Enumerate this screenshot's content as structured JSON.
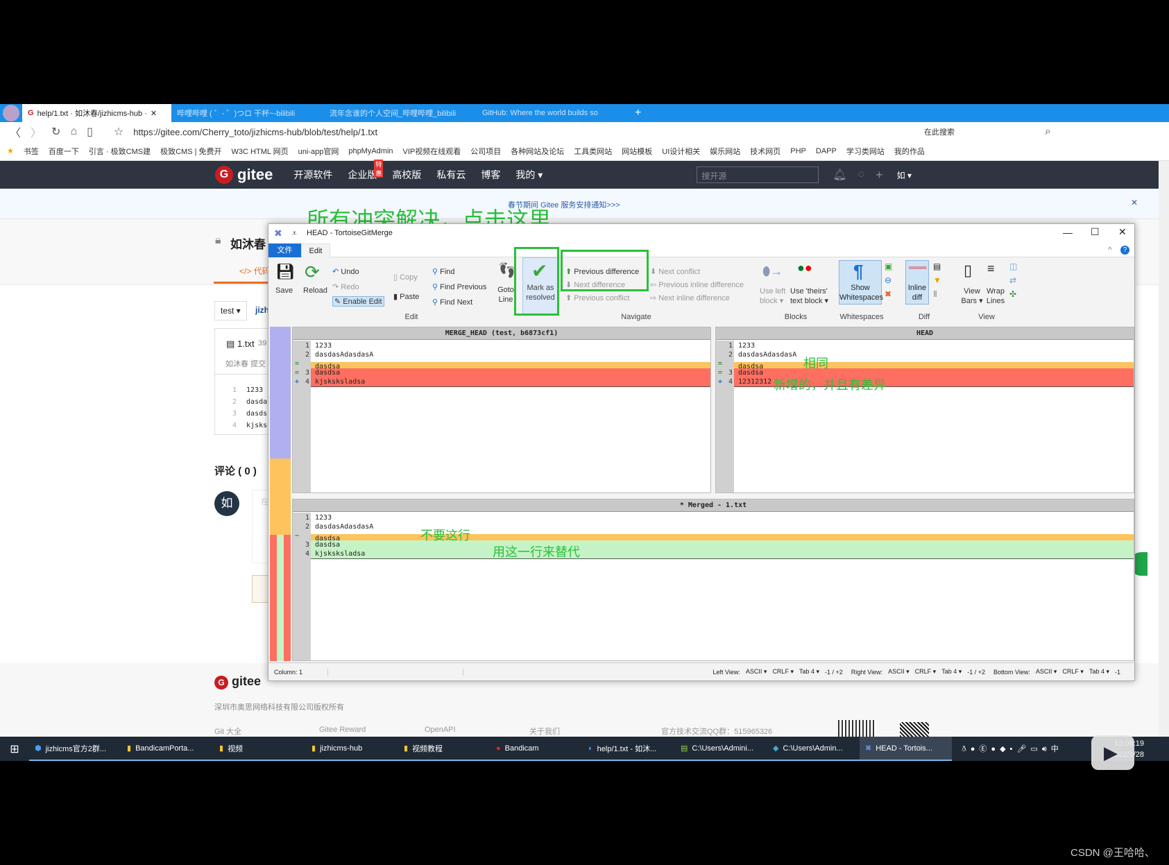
{
  "browser": {
    "tabs": [
      {
        "label": "help/1.txt · 如沐春/jizhicms-hub ·"
      },
      {
        "label": "哔哩哔哩 ( ゜- ゜)つロ 干杯~-bilibili"
      },
      {
        "label": "流年念谁的个人空间_哔哩哔哩_bilibili"
      },
      {
        "label": "GitHub: Where the world builds so"
      }
    ],
    "new_tab": "+",
    "url": "https://gitee.com/Cherry_toto/jizhicms-hub/blob/test/help/1.txt",
    "search_placeholder": "在此搜索",
    "bookmarks": [
      "书签",
      "百度一下",
      "引言 · 极致CMS建",
      "极致CMS | 免费开",
      "W3C HTML 网页",
      "uni-app官网",
      "phpMyAdmin",
      "VIP视频在线观看",
      "公司项目",
      "各种网站及论坛",
      "工具类网站",
      "网站模板",
      "UI设计相关",
      "娱乐网站",
      "技术网页",
      "PHP",
      "DAPP",
      "学习类网站",
      "我的作品"
    ]
  },
  "gitee": {
    "logo": "gitee",
    "nav": [
      "开源软件",
      "企业版",
      "高校版",
      "私有云",
      "博客",
      "我的 ▾"
    ],
    "badge": "特惠",
    "search_placeholder": "搜开源",
    "user": "如 ▾",
    "notice": "春节期间 Gitee 服务安排通知>>>",
    "repo_title": "如沐春",
    "code_tab": "</> 代码",
    "branch": "test ▾",
    "repo_link": "jizh",
    "file_name": "1.txt",
    "file_size": "39",
    "commit": "如沐春 提交",
    "file_lines": [
      {
        "n": "1",
        "t": "1233"
      },
      {
        "n": "2",
        "t": "dasda"
      },
      {
        "n": "3",
        "t": "dasds"
      },
      {
        "n": "4",
        "t": "kjsks"
      }
    ],
    "comments": "评论 ( 0 )",
    "avatar": "如",
    "comment_placeholder": "在",
    "footer_logo": "gitee",
    "copyright": "深圳市奥思网络科技有限公司版权所有",
    "footer_links": [
      "Git 大全",
      "Gitee Reward",
      "OpenAPI",
      "关于我们",
      "官方技术交流QQ群：515965326"
    ]
  },
  "merge": {
    "title": "HEAD - TortoiseGitMerge",
    "tabs": [
      "文件",
      "Edit"
    ],
    "edit": {
      "save": "Save",
      "reload": "Reload",
      "undo": "Undo",
      "redo": "Redo",
      "enable_edit": "Enable Edit",
      "copy": "Copy",
      "paste": "Paste",
      "find": "Find",
      "find_previous": "Find Previous",
      "find_next": "Find Next",
      "goto_line": "Goto Line",
      "mark_resolved": "Mark as resolved"
    },
    "navigate": {
      "prev_diff": "Previous difference",
      "next_diff": "Next difference",
      "prev_conflict": "Previous conflict",
      "next_conflict": "Next conflict",
      "prev_inline": "Previous inline difference",
      "next_inline": "Next inline difference"
    },
    "blocks": {
      "use_left": "Use left block ▾",
      "use_theirs": "Use 'theirs' text block ▾"
    },
    "whitespaces": {
      "show": "Show Whitespaces"
    },
    "diff": {
      "inline": "Inline diff"
    },
    "view": {
      "view_bars": "View Bars ▾",
      "wrap_lines": "Wrap Lines"
    },
    "groups": [
      "Edit",
      "Navigate",
      "Blocks",
      "Whitespaces",
      "Diff",
      "View"
    ],
    "left_pane": {
      "header": "MERGE_HEAD (test, b6873cf1)",
      "lines": [
        {
          "mark": "",
          "n": "1",
          "text": "1233",
          "state": "normal"
        },
        {
          "mark": "",
          "n": "2",
          "text": "dasdasAdasdasA",
          "state": "normal"
        },
        {
          "mark": "=",
          "n": "",
          "text": "dasdsa",
          "state": "removed"
        },
        {
          "mark": "=",
          "n": "3",
          "text": "dasdsa",
          "state": "conflict"
        },
        {
          "mark": "+",
          "n": "4",
          "text": "kjsksksladsa",
          "state": "conflict"
        }
      ]
    },
    "right_pane": {
      "header": "HEAD",
      "lines": [
        {
          "mark": "",
          "n": "1",
          "text": "1233",
          "state": "normal"
        },
        {
          "mark": "",
          "n": "2",
          "text": "dasdasAdasdasA",
          "state": "normal"
        },
        {
          "mark": "=",
          "n": "",
          "text": "dasdsa",
          "state": "removed"
        },
        {
          "mark": "=",
          "n": "3",
          "text": "dasdsa",
          "state": "conflict"
        },
        {
          "mark": "+",
          "n": "4",
          "text": "12312312",
          "state": "conflict"
        }
      ]
    },
    "bottom_pane": {
      "header": "* Merged - 1.txt",
      "lines": [
        {
          "mark": "",
          "n": "1",
          "text": "1233",
          "state": "normal"
        },
        {
          "mark": "",
          "n": "2",
          "text": "dasdasAdasdasA",
          "state": "normal"
        },
        {
          "mark": "−",
          "n": "",
          "text": "dasdsa",
          "state": "removed"
        },
        {
          "mark": "",
          "n": "3",
          "text": "dasdsa",
          "state": "resolved"
        },
        {
          "mark": "",
          "n": "4",
          "text": "kjsksksladsa",
          "state": "resolved"
        }
      ]
    },
    "status": {
      "column": "Column: 1",
      "left_view": "Left View:",
      "right_view": "Right View:",
      "bottom_view": "Bottom View:",
      "encoding": "ASCII ▾",
      "eol": "CRLF ▾",
      "tab": "Tab 4 ▾",
      "left_count": "-1 / +2",
      "right_count": "-1 / +2",
      "bottom_count": "-1"
    },
    "colors": {
      "removed": "#fdc35c",
      "conflict": "#ff6f61",
      "resolved": "#c6f3c6",
      "accent": "#1f6fd6"
    }
  },
  "annotations": {
    "click_here": "所有冲突解决，点击这里",
    "same": "相同",
    "added_diff": "新增的，并且有差异",
    "drop_line": "不要这行",
    "replace_line": "用这一行来替代",
    "color": "#2bbf3b"
  },
  "taskbar": {
    "items": [
      "jizhicms官方2群...",
      "BandicamPorta...",
      "视频",
      "jizhicms-hub",
      "视频教程",
      "Bandicam",
      "help/1.txt - 如沐...",
      "C:\\Users\\Admini...",
      "C:\\Users\\Admin...",
      "HEAD - Tortois..."
    ],
    "time": "13:06:19",
    "date": "2022/1/28"
  },
  "watermark": "CSDN @王哈哈、"
}
